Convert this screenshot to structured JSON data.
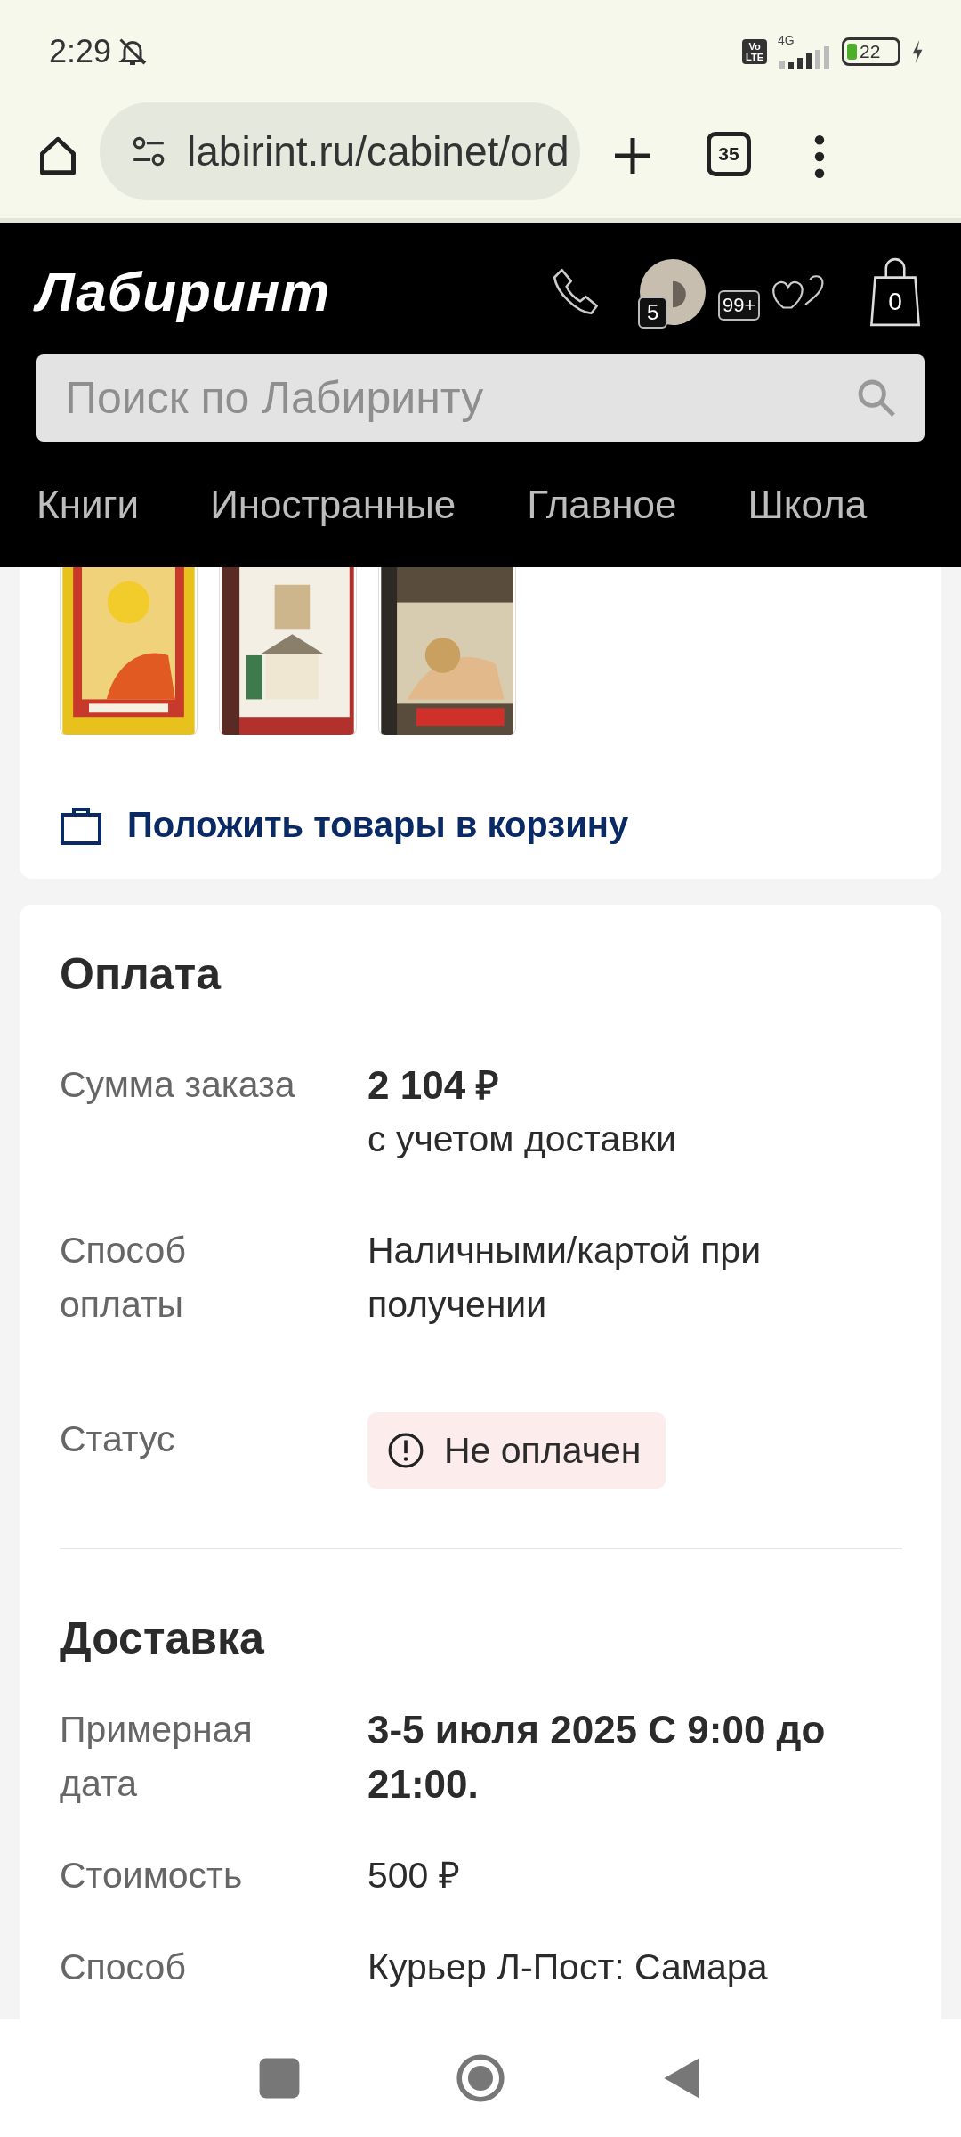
{
  "status_bar": {
    "time": "2:29",
    "volte": [
      "Vo",
      "LTE"
    ],
    "network": "4G",
    "battery": "22"
  },
  "browser": {
    "url": "labirint.ru/cabinet/ord",
    "tab_count": "35"
  },
  "header": {
    "logo": "Лабиринт",
    "avatar_badge": "5",
    "favorites_badge": "99+",
    "cart_badge": "0",
    "search": {
      "placeholder": "Поиск по Лабиринту"
    },
    "nav": [
      "Книги",
      "Иностранные",
      "Главное",
      "Школа"
    ]
  },
  "order_card": {
    "basket_link": "Положить товары в корзину"
  },
  "sections": [
    {
      "kind": "payment",
      "title": "Оплата",
      "rows": [
        {
          "kind": "amount",
          "label": "Сумма заказа",
          "value": "2 104 ₽",
          "note": "с учетом доставки"
        },
        {
          "kind": "text",
          "label": "Способ оплаты",
          "value": "Наличными/картой при получении"
        },
        {
          "kind": "status",
          "label": "Статус",
          "value": "Не оплачен"
        }
      ]
    },
    {
      "kind": "delivery",
      "title": "Доставка",
      "rows": [
        {
          "kind": "bold",
          "label": "Примерная дата",
          "value": "3-5 июля 2025 С 9:00 до 21:00."
        },
        {
          "kind": "text",
          "label": "Стоимость",
          "value": "500 ₽"
        },
        {
          "kind": "text",
          "label": "Способ",
          "value": "Курьер Л-Пост: Самара"
        }
      ]
    }
  ]
}
